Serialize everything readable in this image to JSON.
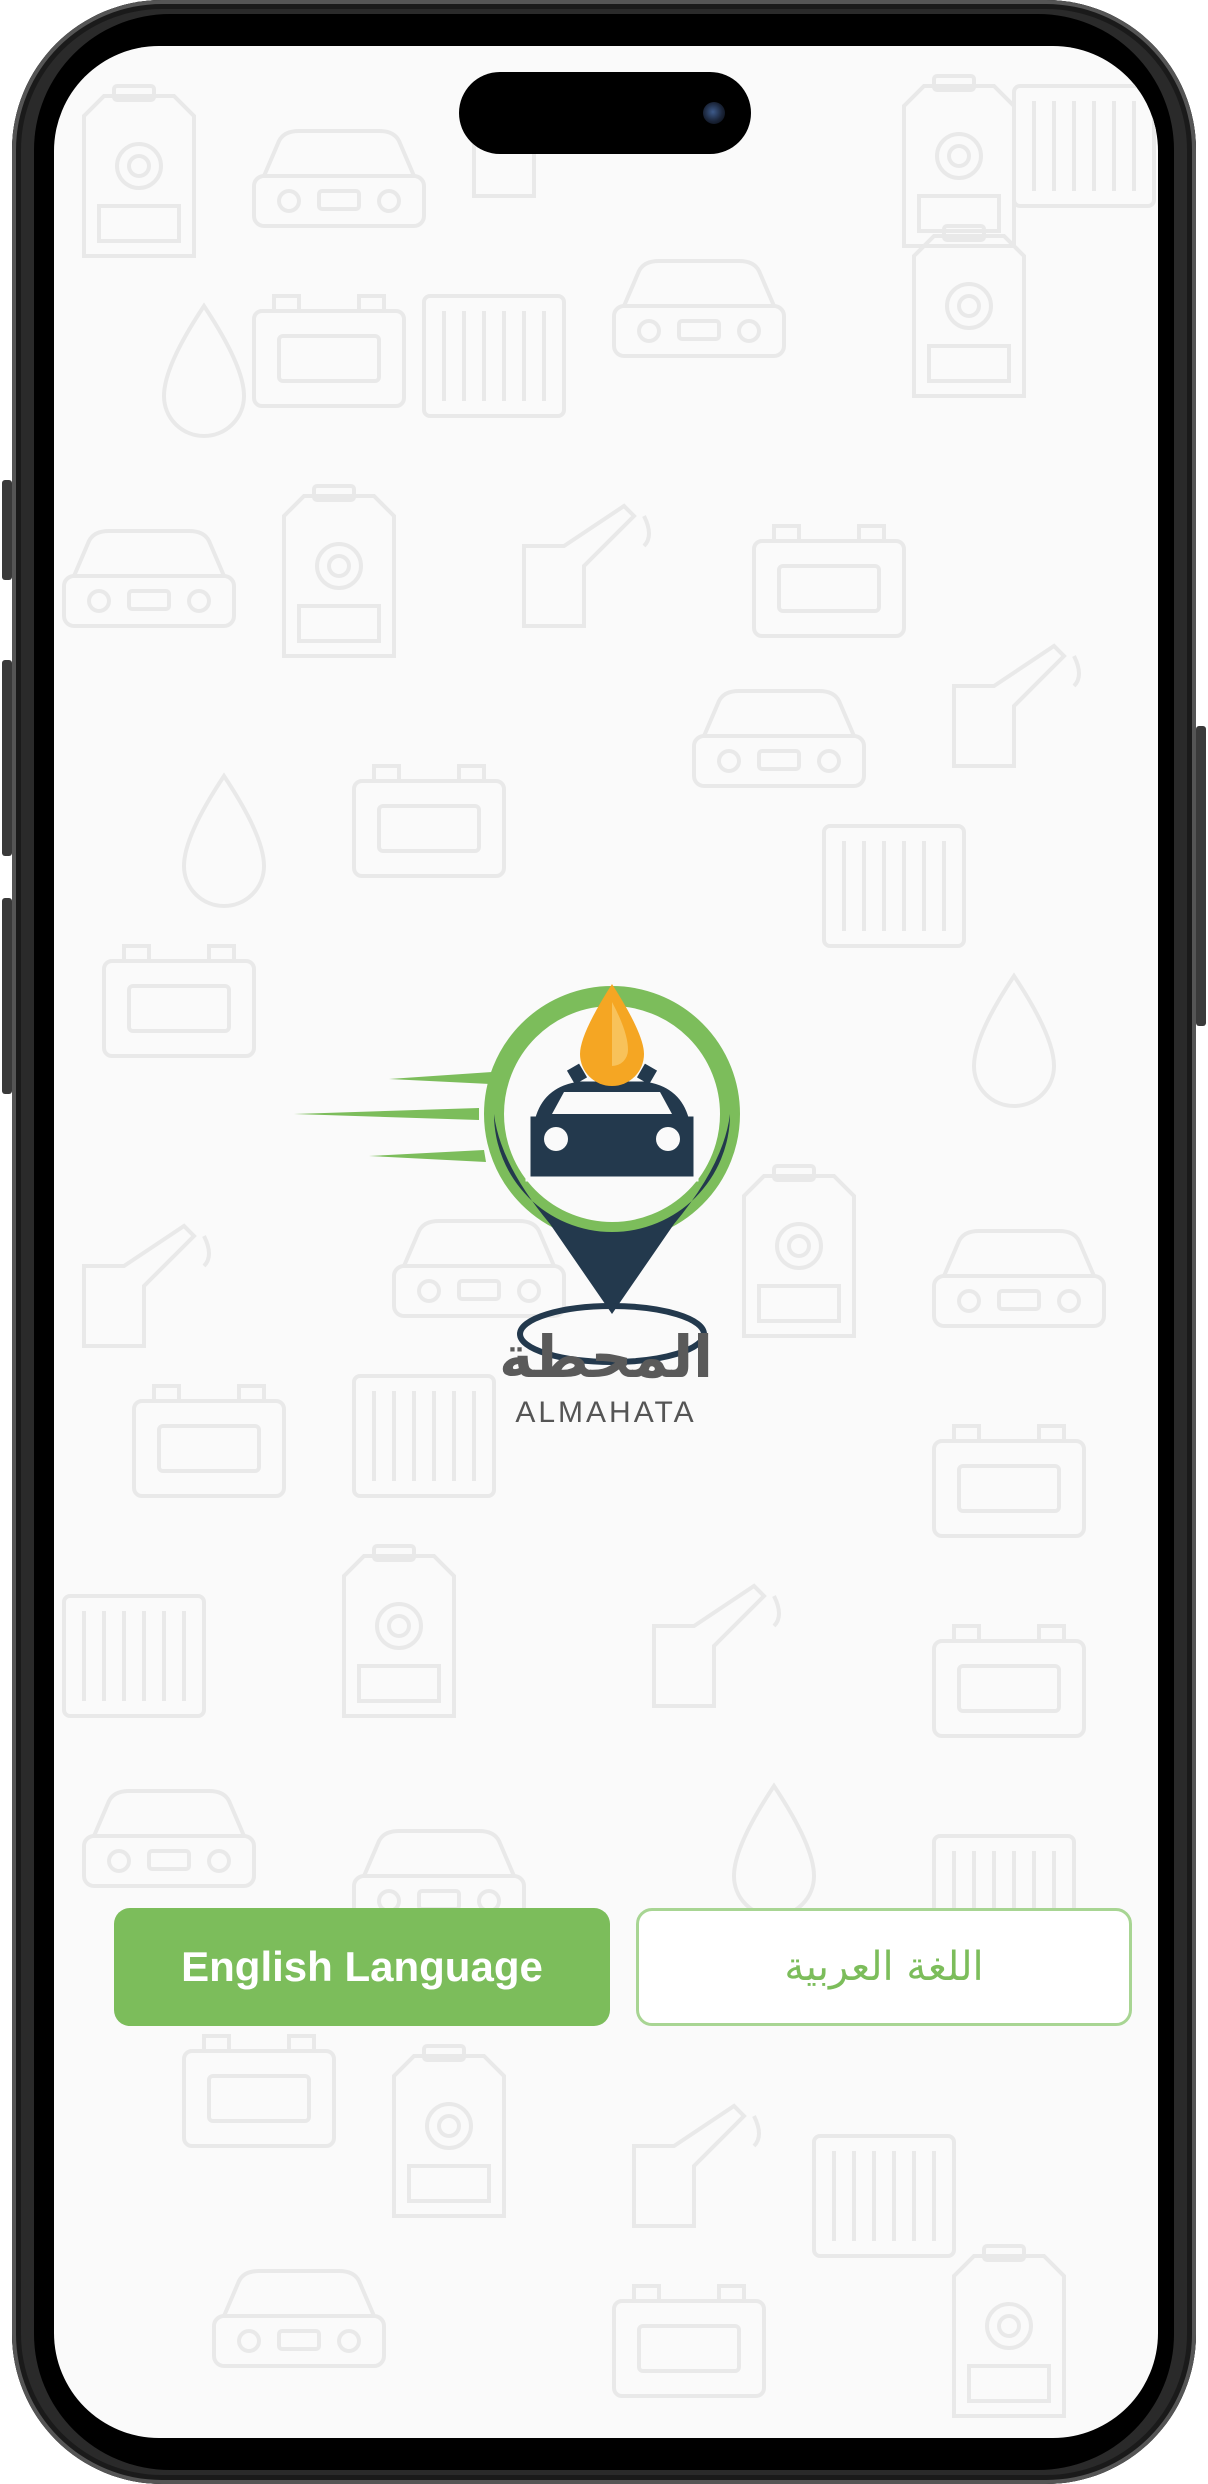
{
  "app": {
    "name_arabic": "المحطة",
    "name_latin": "ALMAHATA"
  },
  "language_selection": {
    "english_label": "English Language",
    "arabic_label": "اللغة العربية"
  },
  "colors": {
    "accent_green": "#7cbd5b",
    "logo_navy": "#23394d",
    "oil_drop": "#f5a623",
    "background": "#fafafa"
  },
  "icons": {
    "logo": "location-pin-car-oil-drop-icon",
    "background": "car-service-pattern"
  }
}
